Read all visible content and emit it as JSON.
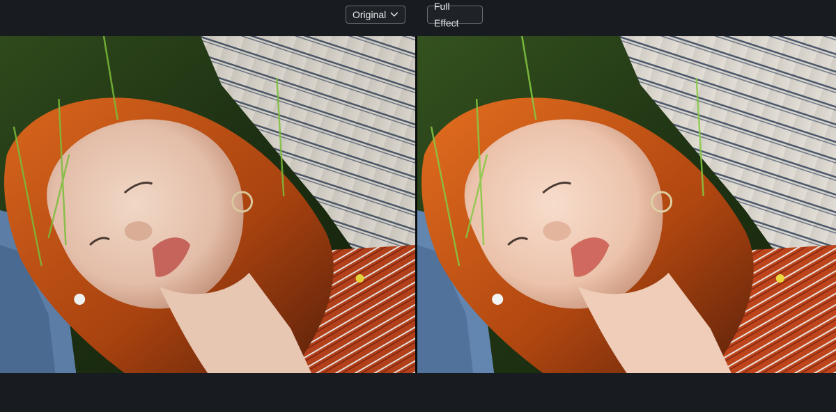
{
  "toolbar": {
    "original_label": "Original",
    "full_effect_label": "Full Effect"
  },
  "icons": {
    "dropdown": "chevron-down-icon"
  },
  "colors": {
    "background": "#181c20",
    "button_border": "#6a6f76",
    "button_text": "#e6e8ea"
  }
}
